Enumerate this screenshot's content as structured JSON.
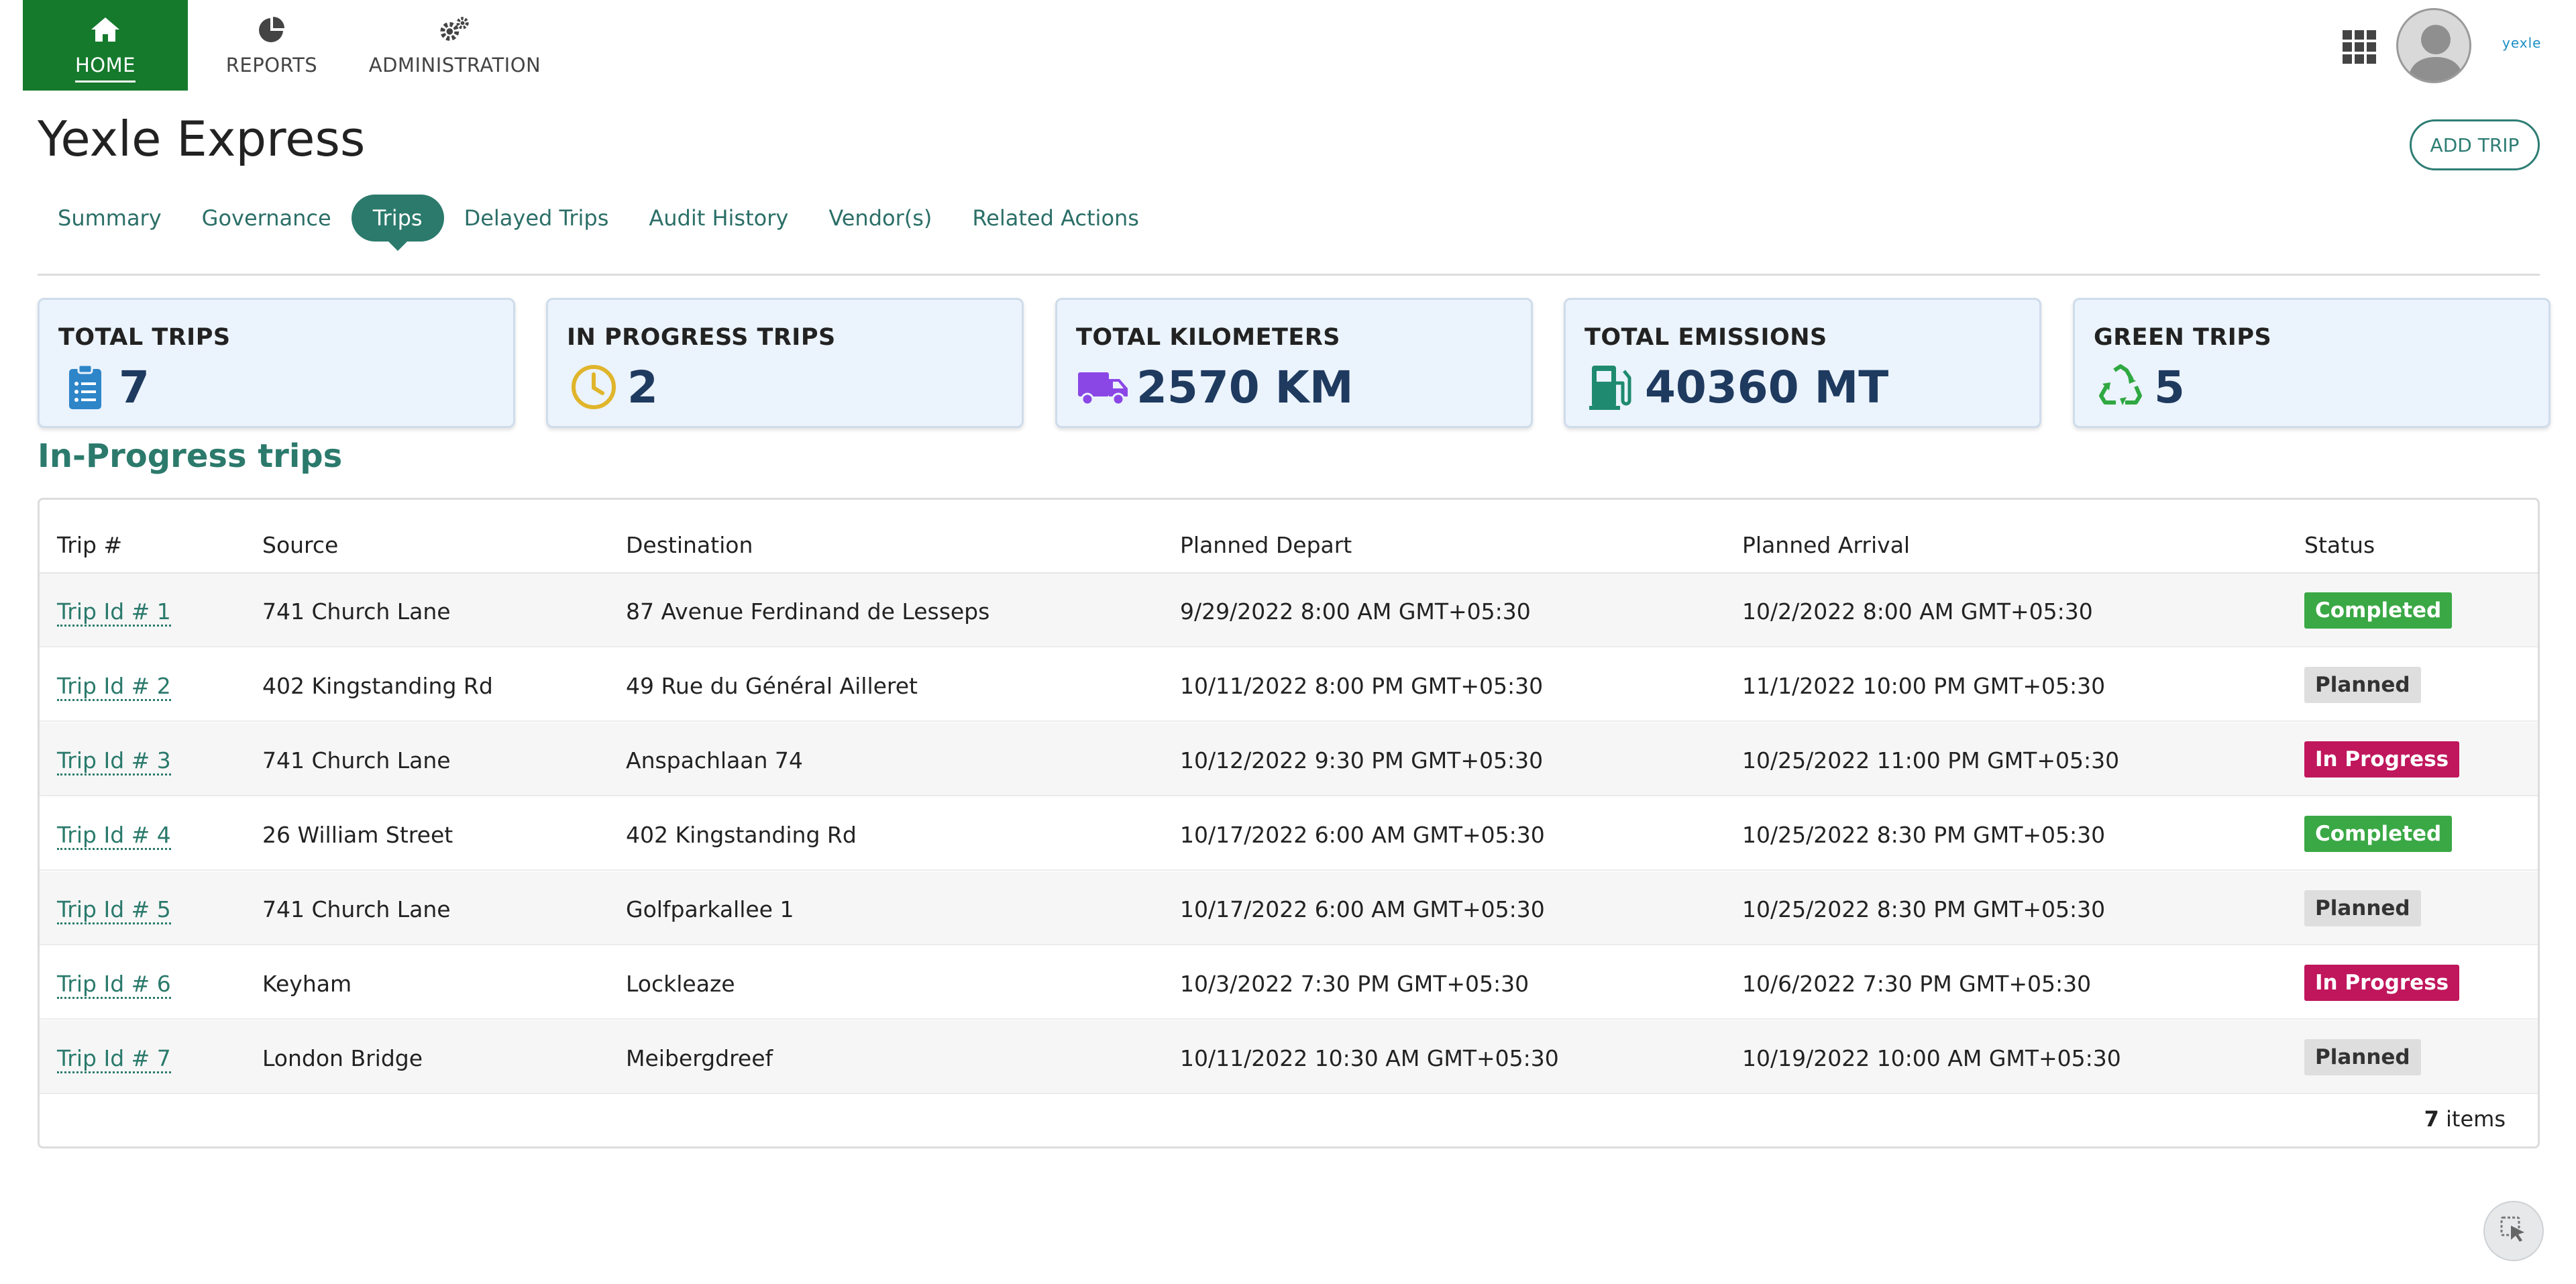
{
  "nav": {
    "home": {
      "label": "HOME",
      "icon": "home-icon"
    },
    "reports": {
      "label": "REPORTS",
      "icon": "pie-chart-icon"
    },
    "administration": {
      "label": "ADMINISTRATION",
      "icon": "gears-icon"
    },
    "brand": "yexle"
  },
  "page": {
    "title": "Yexle Express",
    "add_trip_label": "ADD TRIP"
  },
  "tabs": [
    {
      "label": "Summary",
      "active": false
    },
    {
      "label": "Governance",
      "active": false
    },
    {
      "label": "Trips",
      "active": true
    },
    {
      "label": "Delayed Trips",
      "active": false
    },
    {
      "label": "Audit History",
      "active": false
    },
    {
      "label": "Vendor(s)",
      "active": false
    },
    {
      "label": "Related Actions",
      "active": false
    }
  ],
  "stats": [
    {
      "title": "TOTAL TRIPS",
      "value": "7",
      "icon": "clipboard-list-icon",
      "color": "#2e86c9"
    },
    {
      "title": "IN PROGRESS TRIPS",
      "value": "2",
      "icon": "clock-icon",
      "color": "#e0b52b"
    },
    {
      "title": "TOTAL KILOMETERS",
      "value": "2570 KM",
      "icon": "truck-icon",
      "color": "#8a47e6"
    },
    {
      "title": "TOTAL EMISSIONS",
      "value": "40360 MT",
      "icon": "gas-pump-icon",
      "color": "#1f8a6f"
    },
    {
      "title": "GREEN TRIPS",
      "value": "5",
      "icon": "recycle-icon",
      "color": "#2fa841"
    }
  ],
  "section_title": "In-Progress trips",
  "table": {
    "columns": [
      "Trip #",
      "Source",
      "Destination",
      "Planned Depart",
      "Planned Arrival",
      "Status"
    ],
    "rows": [
      {
        "trip": "Trip Id # 1",
        "source": "741 Church Lane",
        "destination": "87 Avenue Ferdinand de Lesseps",
        "depart": "9/29/2022 8:00 AM GMT+05:30",
        "arrival": "10/2/2022 8:00 AM GMT+05:30",
        "status": "Completed"
      },
      {
        "trip": "Trip Id # 2",
        "source": "402 Kingstanding Rd",
        "destination": "49 Rue du Général Ailleret",
        "depart": "10/11/2022 8:00 PM GMT+05:30",
        "arrival": "11/1/2022 10:00 PM GMT+05:30",
        "status": "Planned"
      },
      {
        "trip": "Trip Id # 3",
        "source": "741 Church Lane",
        "destination": "Anspachlaan 74",
        "depart": "10/12/2022 9:30 PM GMT+05:30",
        "arrival": "10/25/2022 11:00 PM GMT+05:30",
        "status": "In Progress"
      },
      {
        "trip": "Trip Id # 4",
        "source": "26 William Street",
        "destination": "402 Kingstanding Rd",
        "depart": "10/17/2022 6:00 AM GMT+05:30",
        "arrival": "10/25/2022 8:30 PM GMT+05:30",
        "status": "Completed"
      },
      {
        "trip": "Trip Id # 5",
        "source": "741 Church Lane",
        "destination": "Golfparkallee 1",
        "depart": "10/17/2022 6:00 AM GMT+05:30",
        "arrival": "10/25/2022 8:30 PM GMT+05:30",
        "status": "Planned"
      },
      {
        "trip": "Trip Id # 6",
        "source": "Keyham",
        "destination": "Lockleaze",
        "depart": "10/3/2022 7:30 PM GMT+05:30",
        "arrival": "10/6/2022 7:30 PM GMT+05:30",
        "status": "In Progress"
      },
      {
        "trip": "Trip Id # 7",
        "source": "London Bridge",
        "destination": "Meibergdreef",
        "depart": "10/11/2022 10:30 AM GMT+05:30",
        "arrival": "10/19/2022 10:00 AM GMT+05:30",
        "status": "Planned"
      }
    ],
    "footer_count": "7",
    "footer_label": " items"
  },
  "status_colors": {
    "Completed": "#3aa845",
    "Planned": "#dedede",
    "In Progress": "#c0165c"
  }
}
